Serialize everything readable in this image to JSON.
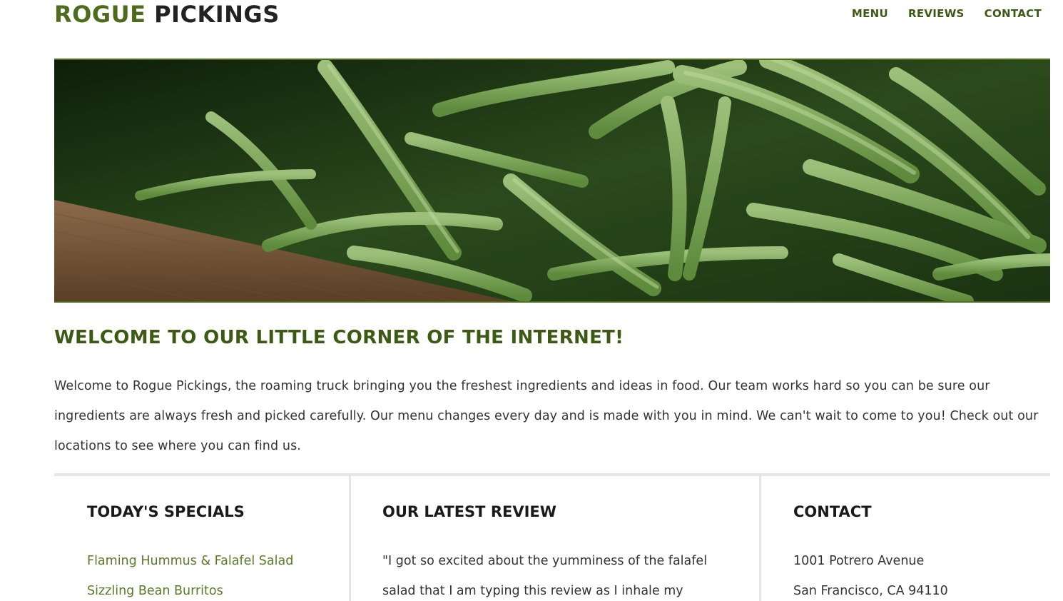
{
  "header": {
    "logo_part1": "ROGUE",
    "logo_part2": "PICKINGS",
    "nav": [
      {
        "label": "MENU"
      },
      {
        "label": "REVIEWS"
      },
      {
        "label": "CONTACT"
      }
    ]
  },
  "hero": {
    "image": "green-beans-photo"
  },
  "welcome": {
    "title": "WELCOME TO OUR LITTLE CORNER OF THE INTERNET!",
    "body": "Welcome to Rogue Pickings, the roaming truck bringing you the freshest ingredients and ideas in food. Our team works hard so you can be sure our ingredients are always fresh and picked carefully. Our menu changes every day and is made with you in mind. We can't wait to come to you! Check out our locations to see where you can find us."
  },
  "specials": {
    "title": "TODAY'S SPECIALS",
    "items": [
      "Flaming Hummus & Falafel Salad",
      "Sizzling Bean Burritos"
    ]
  },
  "review": {
    "title": "OUR LATEST REVIEW",
    "text": "\"I got so excited about the yumminess of the falafel salad that I am typing this review as I inhale my"
  },
  "contact": {
    "title": "CONTACT",
    "address_line1": "1001 Potrero Avenue",
    "address_line2": "San Francisco, CA 94110"
  },
  "colors": {
    "brand_green": "#4f6b1c",
    "nav_green": "#3d5a14",
    "link_green": "#5a7a26",
    "divider": "#e6e6e6"
  }
}
